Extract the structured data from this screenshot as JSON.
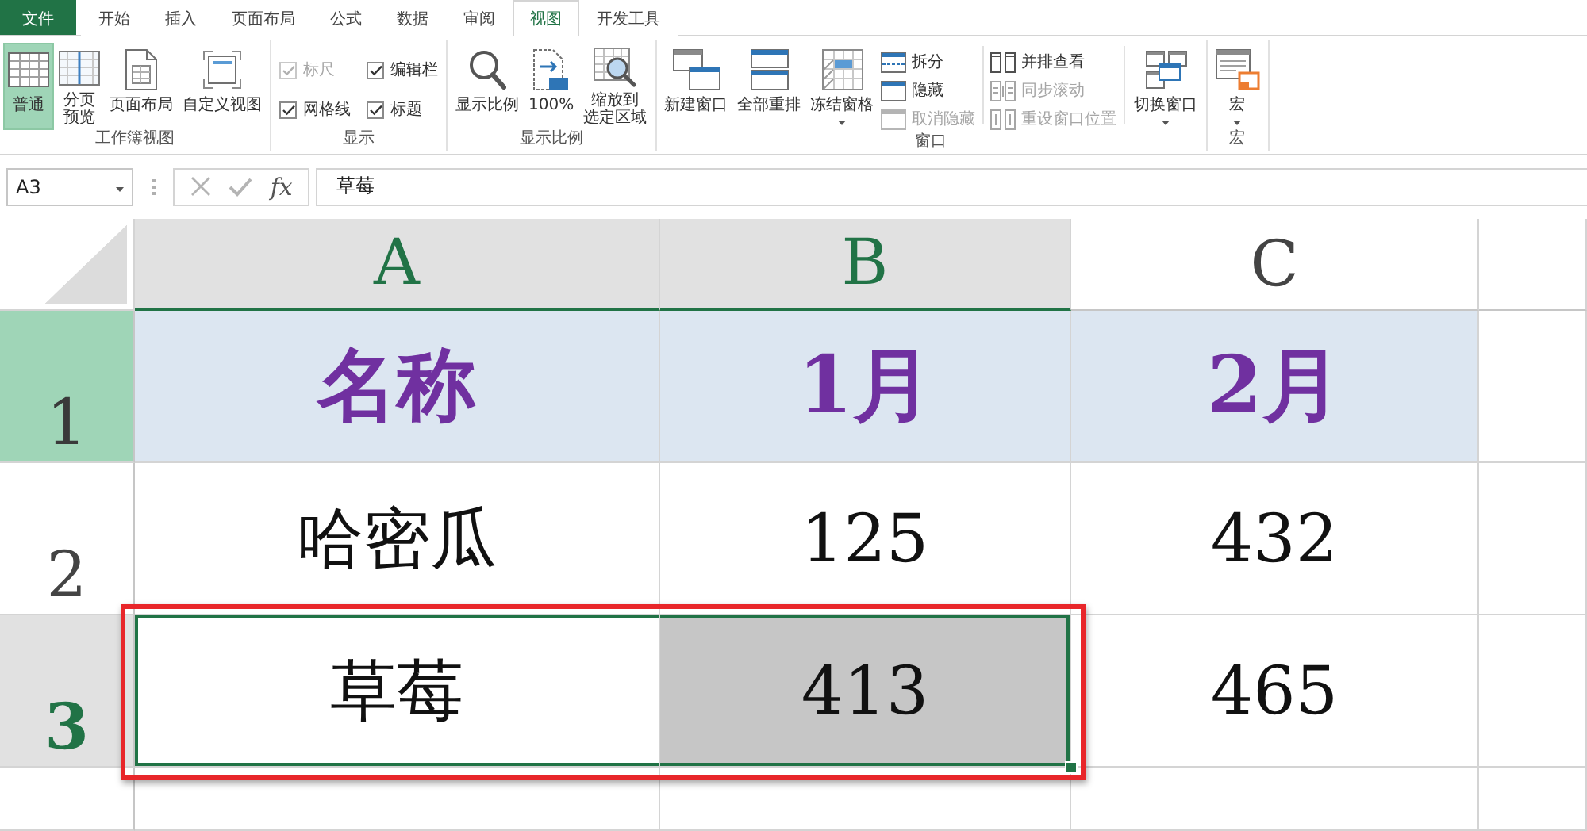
{
  "tabs": [
    {
      "label": "文件",
      "kind": "file",
      "selected": false
    },
    {
      "label": "开始",
      "kind": "tab",
      "selected": false
    },
    {
      "label": "插入",
      "kind": "tab",
      "selected": false
    },
    {
      "label": "页面布局",
      "kind": "tab",
      "selected": false
    },
    {
      "label": "公式",
      "kind": "tab",
      "selected": false
    },
    {
      "label": "数据",
      "kind": "tab",
      "selected": false
    },
    {
      "label": "审阅",
      "kind": "tab",
      "selected": false
    },
    {
      "label": "视图",
      "kind": "tab",
      "selected": true
    },
    {
      "label": "开发工具",
      "kind": "tab",
      "selected": false
    }
  ],
  "ribbon": {
    "groups": [
      {
        "label": "工作簿视图",
        "buttons": [
          {
            "label": "普通",
            "kind": "large",
            "selected": true
          },
          {
            "lines": [
              "分页",
              "预览"
            ],
            "kind": "large",
            "selected": false
          },
          {
            "label": "页面布局",
            "kind": "large",
            "selected": false
          },
          {
            "label": "自定义视图",
            "kind": "large",
            "selected": false
          }
        ]
      },
      {
        "label": "显示",
        "checkboxes": [
          {
            "label": "标尺",
            "checked": true,
            "disabled": true
          },
          {
            "label": "编辑栏",
            "checked": true,
            "disabled": false
          },
          {
            "label": "网格线",
            "checked": true,
            "disabled": false
          },
          {
            "label": "标题",
            "checked": true,
            "disabled": false
          }
        ]
      },
      {
        "label": "显示比例",
        "buttons": [
          {
            "label": "显示比例",
            "kind": "large"
          },
          {
            "label": "100%",
            "kind": "large"
          },
          {
            "lines": [
              "缩放到",
              "选定区域"
            ],
            "kind": "large"
          }
        ]
      },
      {
        "label": "窗口",
        "buttons": [
          {
            "label": "新建窗口",
            "kind": "large",
            "disabled": false
          },
          {
            "label": "全部重排",
            "kind": "large",
            "disabled": false
          },
          {
            "label": "冻结窗格",
            "kind": "dropdown",
            "disabled": false
          },
          {
            "label": "拆分",
            "kind": "small",
            "disabled": false
          },
          {
            "label": "隐藏",
            "kind": "small",
            "disabled": false
          },
          {
            "label": "取消隐藏",
            "kind": "small",
            "disabled": true
          },
          {
            "label": "并排查看",
            "kind": "small",
            "disabled": false
          },
          {
            "label": "同步滚动",
            "kind": "small",
            "disabled": true
          },
          {
            "label": "重设窗口位置",
            "kind": "small",
            "disabled": true
          },
          {
            "label": "切换窗口",
            "kind": "dropdown",
            "disabled": false
          }
        ]
      },
      {
        "label": "宏",
        "buttons": [
          {
            "label": "宏",
            "kind": "dropdown"
          }
        ]
      }
    ]
  },
  "formula_bar": {
    "name_box": "A3",
    "insert_function": "fx",
    "formula": "草莓"
  },
  "sheet": {
    "columns": [
      {
        "label": "A",
        "selected": true
      },
      {
        "label": "B",
        "selected": true
      },
      {
        "label": "C",
        "selected": false
      }
    ],
    "rows": [
      {
        "label": "1",
        "selected": false,
        "highlighted": true,
        "kind": "title",
        "cells": [
          {
            "text": "名称",
            "selected": false,
            "framed": false
          },
          {
            "text": "1月",
            "selected": false,
            "framed": false
          },
          {
            "text": "2月",
            "selected": false,
            "framed": false
          }
        ]
      },
      {
        "label": "2",
        "selected": false,
        "highlighted": false,
        "kind": "data",
        "cells": [
          {
            "text": "哈密瓜",
            "selected": false,
            "framed": false
          },
          {
            "text": "125",
            "selected": false,
            "framed": false
          },
          {
            "text": "432",
            "selected": false,
            "framed": false
          }
        ]
      },
      {
        "label": "3",
        "selected": true,
        "highlighted": false,
        "kind": "data",
        "cells": [
          {
            "text": "草莓",
            "selected": true,
            "framed": true
          },
          {
            "text": "413",
            "selected": true,
            "framed": true
          },
          {
            "text": "465",
            "selected": false,
            "framed": false
          }
        ]
      }
    ]
  }
}
